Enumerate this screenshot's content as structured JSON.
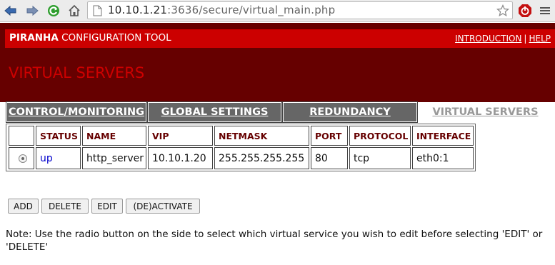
{
  "browser": {
    "url_host": "10.10.1.21",
    "url_path": ":3636/secure/virtual_main.php"
  },
  "header": {
    "brand_bold": "PIRANHA",
    "brand_rest": " CONFIGURATION TOOL",
    "link_intro": "INTRODUCTION",
    "separator": "|",
    "link_help": "HELP"
  },
  "section_title": "VIRTUAL SERVERS",
  "tabs": [
    {
      "label": "CONTROL/MONITORING",
      "active": false
    },
    {
      "label": "GLOBAL SETTINGS",
      "active": false
    },
    {
      "label": "REDUNDANCY",
      "active": false
    },
    {
      "label": "VIRTUAL SERVERS",
      "active": true
    }
  ],
  "table": {
    "headers": [
      "STATUS",
      "NAME",
      "VIP",
      "NETMASK",
      "PORT",
      "PROTOCOL",
      "INTERFACE"
    ],
    "rows": [
      {
        "status": "up",
        "name": "http_server",
        "vip": "10.10.1.20",
        "netmask": "255.255.255.255",
        "port": "80",
        "protocol": "tcp",
        "interface": "eth0:1",
        "selected": true
      }
    ]
  },
  "buttons": {
    "add": "ADD",
    "delete": "DELETE",
    "edit": "EDIT",
    "activate": "(DE)ACTIVATE"
  },
  "note": "Note: Use the radio button on the side to select which virtual service you wish to edit before selecting 'EDIT' or 'DELETE'",
  "colors": {
    "dark_red": "#660000",
    "bright_red": "#cc0000",
    "tab_grey": "#666666"
  }
}
